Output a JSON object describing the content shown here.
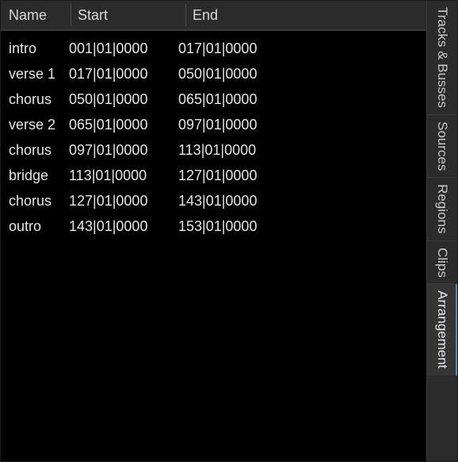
{
  "headers": {
    "name": "Name",
    "start": "Start",
    "end": "End"
  },
  "rows": [
    {
      "name": "intro",
      "start": "001|01|0000",
      "end": "017|01|0000"
    },
    {
      "name": "verse 1",
      "start": "017|01|0000",
      "end": "050|01|0000"
    },
    {
      "name": "chorus",
      "start": "050|01|0000",
      "end": "065|01|0000"
    },
    {
      "name": "verse 2",
      "start": "065|01|0000",
      "end": "097|01|0000"
    },
    {
      "name": "chorus",
      "start": "097|01|0000",
      "end": "113|01|0000"
    },
    {
      "name": "bridge",
      "start": "113|01|0000",
      "end": "127|01|0000"
    },
    {
      "name": "chorus",
      "start": "127|01|0000",
      "end": "143|01|0000"
    },
    {
      "name": "outro",
      "start": "143|01|0000",
      "end": "153|01|0000"
    }
  ],
  "tabs": [
    {
      "label": "Tracks & Busses",
      "active": false
    },
    {
      "label": "Sources",
      "active": false
    },
    {
      "label": "Regions",
      "active": false
    },
    {
      "label": "Clips",
      "active": false
    },
    {
      "label": "Arrangement",
      "active": true
    }
  ]
}
